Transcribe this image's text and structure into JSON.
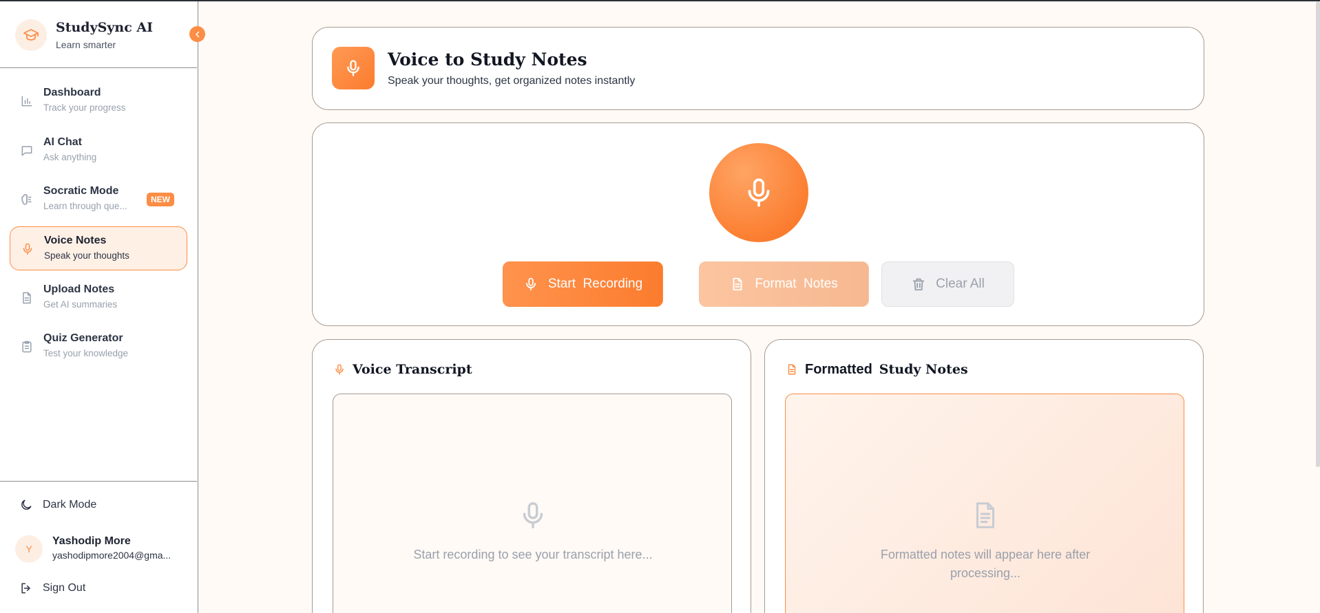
{
  "brand": {
    "title": "StudySync AI",
    "subtitle": "Learn smarter",
    "logo_icon": "graduation-cap-icon"
  },
  "sidebar": {
    "items": [
      {
        "label": "Dashboard",
        "sub": "Track your progress",
        "icon": "bar-chart-icon"
      },
      {
        "label": "AI Chat",
        "sub": "Ask anything",
        "icon": "chat-bubble-icon"
      },
      {
        "label": "Socratic Mode",
        "sub": "Learn through que...",
        "icon": "brain-icon",
        "badge": "NEW"
      },
      {
        "label": "Voice Notes",
        "sub": "Speak your thoughts",
        "icon": "microphone-icon",
        "active": true
      },
      {
        "label": "Upload Notes",
        "sub": "Get AI summaries",
        "icon": "document-icon"
      },
      {
        "label": "Quiz Generator",
        "sub": "Test your knowledge",
        "icon": "clipboard-list-icon"
      }
    ],
    "dark_mode_label": "Dark Mode",
    "user": {
      "initial": "Y",
      "name": "Yashodip More",
      "email": "yashodipmore2004@gma..."
    },
    "sign_out_label": "Sign Out"
  },
  "header": {
    "title": "Voice to Study Notes",
    "subtitle": "Speak your thoughts, get organized notes instantly"
  },
  "controls": {
    "start_label": "Start  Recording",
    "format_label": "Format  Notes",
    "clear_label": "Clear All"
  },
  "transcript": {
    "title": "Voice Transcript",
    "empty_text": "Start recording to see your transcript here..."
  },
  "formatted": {
    "title_bold": "Formatted",
    "title_serif": "Study Notes",
    "empty_text": "Formatted notes will appear here after processing..."
  },
  "colors": {
    "accent": "#fb8d45",
    "accent_dark": "#fb7c2e",
    "text_dark": "#111622",
    "muted": "#9aa0ab"
  }
}
